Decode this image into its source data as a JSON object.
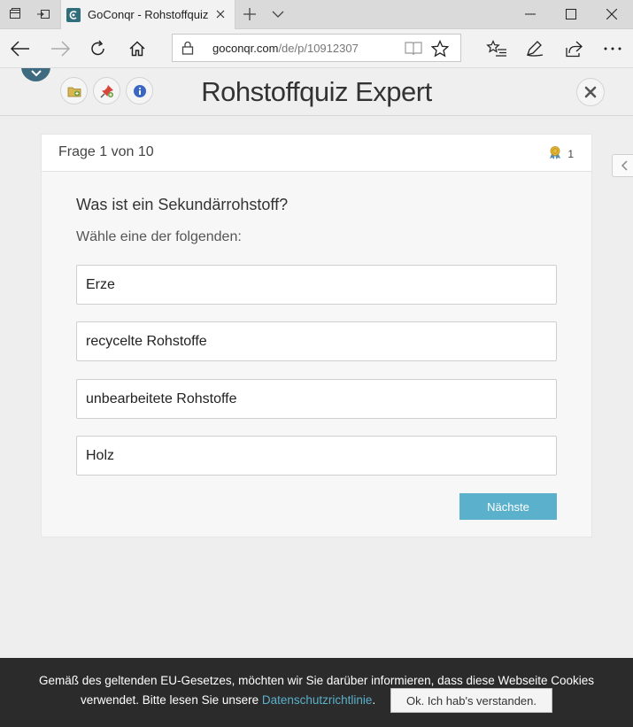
{
  "browser": {
    "tab_title": "GoConqr - Rohstoffquiz",
    "url_host": "goconqr.com",
    "url_path": "/de/p/10912307"
  },
  "quiz": {
    "title": "Rohstoffquiz Expert",
    "counter": "Frage 1 von 10",
    "points": "1",
    "question": "Was ist ein Sekundärrohstoff?",
    "instruction": "Wähle eine der folgenden:",
    "answers": [
      "Erze",
      "recycelte Rohstoffe",
      "unbearbeitete Rohstoffe",
      "Holz"
    ],
    "next_label": "Nächste"
  },
  "cookie": {
    "line1": "Gemäß des geltenden EU-Gesetzes, möchten wir Sie darüber informieren, dass diese Webseite Cookies",
    "line2_before": "verwendet. Bitte lesen Sie unsere ",
    "link": "Datenschutzrichtlinie",
    "line2_after": ".",
    "button": "Ok. Ich hab's verstanden."
  },
  "icons": {
    "tab_favicon": "goconqr-icon",
    "header_buttons": [
      "folder-icon",
      "pin-icon",
      "info-icon"
    ],
    "close": "close-icon",
    "points": "medal-icon"
  },
  "colors": {
    "accent": "#5bb0cb",
    "collapse": "#3e6b80",
    "cookiebar": "#2b2b2b"
  }
}
